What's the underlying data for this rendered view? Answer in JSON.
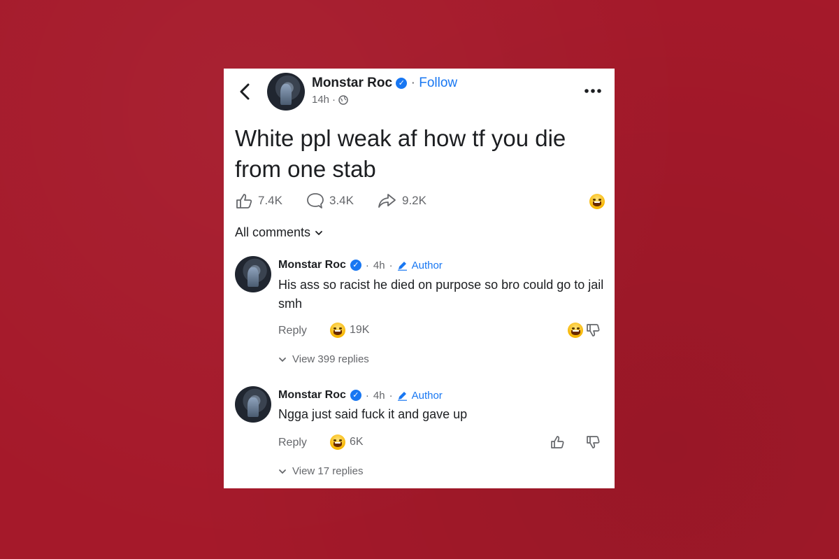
{
  "post": {
    "author": "Monstar Roc",
    "separator": "·",
    "follow_label": "Follow",
    "time": "14h",
    "privacy_icon": "globe-icon",
    "text": "White ppl weak af how tf you die from one stab",
    "likes": "7.4K",
    "comments": "3.4K",
    "shares": "9.2K",
    "reaction_icon": "laughing-emoji"
  },
  "comments_filter": "All comments",
  "comments": [
    {
      "author": "Monstar Roc",
      "time": "4h",
      "badge": "Author",
      "text": "His ass so racist he died on purpose so bro could go to jail smh",
      "reply_label": "Reply",
      "reaction_count": "19K",
      "view_replies": "View 399 replies"
    },
    {
      "author": "Monstar Roc",
      "time": "4h",
      "badge": "Author",
      "text": "Ngga just said fuck it and gave up",
      "reply_label": "Reply",
      "reaction_count": "6K",
      "view_replies": "View 17 replies"
    }
  ],
  "colors": {
    "background": "#a5192a",
    "accent": "#1877f2",
    "text": "#1c1e21",
    "muted": "#65676b"
  }
}
